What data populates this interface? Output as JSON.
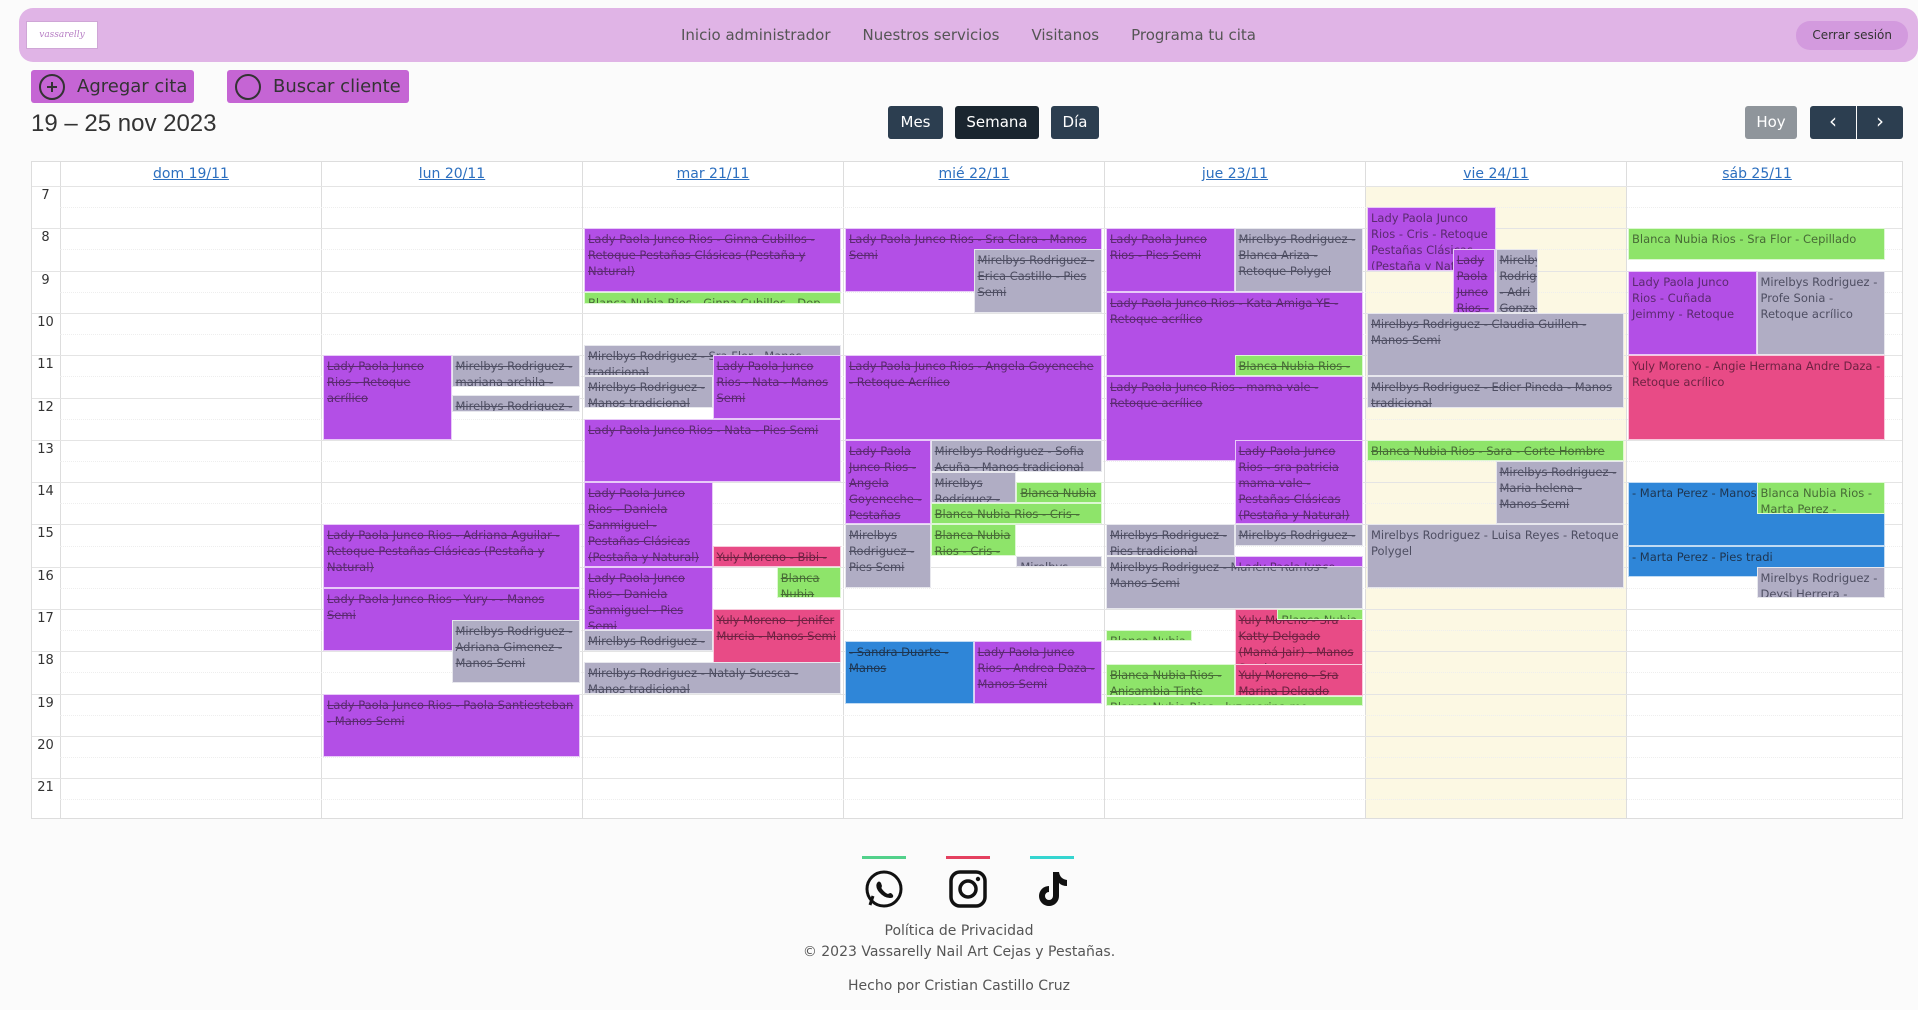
{
  "navbar": {
    "logo_text": "vassarelly",
    "links": [
      "Inicio administrador",
      "Nuestros servicios",
      "Visitanos",
      "Programa tu cita"
    ],
    "logout": "Cerrar sesión"
  },
  "actions": {
    "add": "Agregar cita",
    "search": "Buscar cliente"
  },
  "toolbar": {
    "range": "19 – 25 nov 2023",
    "views": [
      "Mes",
      "Semana",
      "Día"
    ],
    "active_view": "Semana",
    "today": "Hoy",
    "prev_icon": "chevron-left-icon",
    "next_icon": "chevron-right-icon"
  },
  "calendar": {
    "days": [
      "dom 19/11",
      "lun 20/11",
      "mar 21/11",
      "mié 22/11",
      "jue 23/11",
      "vie 24/11",
      "sáb 25/11"
    ],
    "today_index": 5,
    "hours": [
      "7",
      "8",
      "9",
      "10",
      "11",
      "12",
      "13",
      "14",
      "15",
      "16",
      "17",
      "18",
      "19",
      "20",
      "21"
    ],
    "event_colors": {
      "purple": "#b34fe6",
      "gray": "#b0adc4",
      "green": "#8ee46a",
      "pink": "#e84b86",
      "blue": "#2f86d8"
    },
    "events": [
      {
        "day": 1,
        "start": 11,
        "end": 13,
        "lane": 0,
        "lanes": 2,
        "color": "purple",
        "text": "Lady Paola Junco Rios - Retoque acrílico"
      },
      {
        "day": 1,
        "start": 11,
        "end": 11.75,
        "lane": 1,
        "lanes": 2,
        "color": "gray",
        "text": "Mirelbys Rodriguez - mariana archila -"
      },
      {
        "day": 1,
        "start": 11.95,
        "end": 12.35,
        "lane": 1,
        "lanes": 2,
        "color": "gray",
        "text": "Mirelbys Rodriguez -"
      },
      {
        "day": 1,
        "start": 15,
        "end": 16.5,
        "lane": 0,
        "lanes": 1,
        "color": "purple",
        "text": "Lady Paola Junco Rios - Adriana Aguilar - Retoque Pestañas Clásicas (Pestaña y Natural)"
      },
      {
        "day": 1,
        "start": 16.5,
        "end": 18,
        "lane": 0,
        "lanes": 1,
        "color": "purple",
        "text": "Lady Paola Junco Rios - Yury - - Manos Semi"
      },
      {
        "day": 1,
        "start": 17.25,
        "end": 18.75,
        "lane": 1,
        "lanes": 2,
        "color": "gray",
        "text": "Mirelbys Rodriguez - Adriana Gimenez - Manos Semi"
      },
      {
        "day": 1,
        "start": 19,
        "end": 20.5,
        "lane": 0,
        "lanes": 1,
        "color": "purple",
        "text": "Lady Paola Junco Rios - Paola Santiesteban - Manos Semi"
      },
      {
        "day": 2,
        "start": 8,
        "end": 9.5,
        "lane": 0,
        "lanes": 1,
        "color": "purple",
        "text": "Lady Paola Junco Rios - Ginna Cubillos - Retoque Pestañas Clásicas (Pestaña y Natural)"
      },
      {
        "day": 2,
        "start": 9.5,
        "end": 9.8,
        "lane": 0,
        "lanes": 1,
        "color": "green",
        "text": "Blanca Nubia Rios - Ginna Cubillos - Dep"
      },
      {
        "day": 2,
        "start": 10.75,
        "end": 11.5,
        "lane": 0,
        "lanes": 1,
        "color": "gray",
        "text": "Mirelbys Rodriguez - Sra Flor - Manos tradicional"
      },
      {
        "day": 2,
        "start": 11.5,
        "end": 12.25,
        "lane": 0,
        "lanes": 2,
        "color": "gray",
        "text": "Mirelbys Rodriguez - Manos tradicional"
      },
      {
        "day": 2,
        "start": 11,
        "end": 12.5,
        "lane": 1,
        "lanes": 2,
        "color": "purple",
        "text": "Lady Paola Junco Rios - Nata - Manos Semi"
      },
      {
        "day": 2,
        "start": 12.5,
        "end": 14,
        "lane": 0,
        "lanes": 1,
        "color": "purple",
        "text": "Lady Paola Junco Rios - Nata - Pies Semi"
      },
      {
        "day": 2,
        "start": 14,
        "end": 16,
        "lane": 0,
        "lanes": 2,
        "color": "purple",
        "text": "Lady Paola Junco Rios - Daniela Sanmiguel - Pestañas Clásicas (Pestaña y Natural)"
      },
      {
        "day": 2,
        "start": 15.5,
        "end": 16,
        "lane": 1,
        "lanes": 2,
        "color": "pink",
        "text": "Yuly Moreno - Bibi - Manos tradi"
      },
      {
        "day": 2,
        "start": 16,
        "end": 17.5,
        "lane": 0,
        "lanes": 2,
        "color": "purple",
        "text": "Lady Paola Junco Rios - Daniela Sanmiguel - Pies Semi"
      },
      {
        "day": 2,
        "start": 16,
        "end": 16.75,
        "lane": 3,
        "lanes": 4,
        "color": "green",
        "text": "Blanca Nubia Rios -"
      },
      {
        "day": 2,
        "start": 17.5,
        "end": 18,
        "lane": 0,
        "lanes": 2,
        "color": "gray",
        "text": "Mirelbys Rodriguez - Manos tra"
      },
      {
        "day": 2,
        "start": 17,
        "end": 18.5,
        "lane": 1,
        "lanes": 2,
        "color": "pink",
        "text": "Yuly Moreno - Jenifer Murcia - Manos Semi"
      },
      {
        "day": 2,
        "start": 18.25,
        "end": 19,
        "lane": 0,
        "lanes": 1,
        "color": "gray",
        "text": "Mirelbys Rodriguez - Nataly Suesca - Manos tradicional"
      },
      {
        "day": 3,
        "start": 8,
        "end": 9.5,
        "lane": 0,
        "lanes": 1,
        "color": "purple",
        "text": "Lady Paola Junco Rios - Sra Clara - Manos Semi"
      },
      {
        "day": 3,
        "start": 8.5,
        "end": 10,
        "lane": 1,
        "lanes": 2,
        "color": "gray",
        "text": "Mirelbys Rodriguez - Erica Castillo - Pies Semi"
      },
      {
        "day": 3,
        "start": 11,
        "end": 13,
        "lane": 0,
        "lanes": 1,
        "color": "purple",
        "text": "Lady Paola Junco Rios - Angela Goyeneche - Retoque Acrílico"
      },
      {
        "day": 3,
        "start": 13,
        "end": 15,
        "lane": 0,
        "lanes": 3,
        "color": "purple",
        "text": "Lady Paola Junco Rios - Angela Goyeneche - Pestañas Clásicas (Pestaña y Natural)"
      },
      {
        "day": 3,
        "start": 13,
        "end": 13.75,
        "lane": 1,
        "lanes": 3,
        "lanesSpan": 2,
        "color": "gray",
        "text": "Mirelbys Rodriguez - Sofia Acuña - Manos tradicional"
      },
      {
        "day": 3,
        "start": 13.75,
        "end": 14.5,
        "lane": 1,
        "lanes": 3,
        "color": "gray",
        "text": "Mirelbys Rodriguez - Sofia Acuña - Pies"
      },
      {
        "day": 3,
        "start": 14,
        "end": 14.5,
        "lane": 2,
        "lanes": 3,
        "color": "green",
        "text": "Blanca Nubia Rios"
      },
      {
        "day": 3,
        "start": 14.5,
        "end": 15,
        "lane": 1,
        "lanes": 3,
        "lanesSpan": 2,
        "color": "green",
        "text": "Blanca Nubia Rios - Cris -"
      },
      {
        "day": 3,
        "start": 15,
        "end": 16.5,
        "lane": 0,
        "lanes": 3,
        "color": "gray",
        "text": "Mirelbys Rodriguez - Pies Semi"
      },
      {
        "day": 3,
        "start": 15,
        "end": 15.75,
        "lane": 1,
        "lanes": 3,
        "color": "green",
        "text": "Blanca Nubia Rios - Cris - Cepillado"
      },
      {
        "day": 3,
        "start": 15.75,
        "end": 16,
        "lane": 2,
        "lanes": 3,
        "color": "gray",
        "text": "Mirelbys"
      },
      {
        "day": 3,
        "start": 17.75,
        "end": 19.25,
        "lane": 0,
        "lanes": 2,
        "color": "blue",
        "text": "- Sandra Duarte - Manos"
      },
      {
        "day": 3,
        "start": 17.75,
        "end": 19.25,
        "lane": 1,
        "lanes": 2,
        "color": "purple",
        "text": "Lady Paola Junco Rios - Andrea Daza - Manos Semi"
      },
      {
        "day": 4,
        "start": 8,
        "end": 9.5,
        "lane": 0,
        "lanes": 2,
        "color": "purple",
        "text": "Lady Paola Junco Rios - Pies Semi"
      },
      {
        "day": 4,
        "start": 8,
        "end": 9.5,
        "lane": 1,
        "lanes": 2,
        "color": "gray",
        "text": "Mirelbys Rodriguez - Blanca Ariza - Retoque Polygel"
      },
      {
        "day": 4,
        "start": 9.5,
        "end": 11.5,
        "lane": 0,
        "lanes": 1,
        "color": "purple",
        "text": "Lady Paola Junco Rios - Kata Amiga YE - Retoque acrílico"
      },
      {
        "day": 4,
        "start": 11,
        "end": 11.5,
        "lane": 1,
        "lanes": 2,
        "color": "green",
        "text": "Blanca Nubia Rios -"
      },
      {
        "day": 4,
        "start": 11.5,
        "end": 12,
        "lane": 1,
        "lanes": 2,
        "color": "green",
        "text": "Blanca Nubia Rios -"
      },
      {
        "day": 4,
        "start": 11.5,
        "end": 13.5,
        "lane": 0,
        "lanes": 1,
        "color": "purple",
        "text": "Lady Paola Junco Rios - mama vale - Retoque acrílico"
      },
      {
        "day": 4,
        "start": 13,
        "end": 15,
        "lane": 1,
        "lanes": 2,
        "color": "purple",
        "text": "Lady Paola Junco Rios - sra patricia mama vale - Pestañas Clásicas (Pestaña y Natural)"
      },
      {
        "day": 4,
        "start": 15,
        "end": 15.75,
        "lane": 0,
        "lanes": 2,
        "color": "gray",
        "text": "Mirelbys Rodriguez - Pies tradicional"
      },
      {
        "day": 4,
        "start": 15,
        "end": 15.5,
        "lane": 1,
        "lanes": 2,
        "color": "gray",
        "text": "Mirelbys Rodriguez -"
      },
      {
        "day": 4,
        "start": 15.75,
        "end": 17,
        "lane": 0,
        "lanes": 1,
        "color": "gray",
        "text": "Mirelbys Rodriguez - Marlene Ramos - Manos Semi"
      },
      {
        "day": 4,
        "start": 15.75,
        "end": 16,
        "lane": 1,
        "lanes": 2,
        "color": "purple",
        "text": "Lady Paola Junco Rios - sra"
      },
      {
        "day": 4,
        "start": 17,
        "end": 18.5,
        "lane": 1,
        "lanes": 2,
        "color": "pink",
        "text": "Yuly Moreno - Sra Katty Delgado (Mamá Jair) - Manos Semi"
      },
      {
        "day": 4,
        "start": 17,
        "end": 17.25,
        "lane": 2,
        "lanes": 3,
        "color": "green",
        "text": "Blanca Nubia"
      },
      {
        "day": 4,
        "start": 17.5,
        "end": 17.75,
        "lane": 0,
        "lanes": 3,
        "color": "green",
        "text": "Blanca Nubia R"
      },
      {
        "day": 4,
        "start": 18.3,
        "end": 19.05,
        "lane": 0,
        "lanes": 2,
        "color": "green",
        "text": "Blanca Nubia Rios - Anisambia Tinte"
      },
      {
        "day": 4,
        "start": 18.3,
        "end": 19.05,
        "lane": 1,
        "lanes": 2,
        "color": "pink",
        "text": "Yuly Moreno - Sra Marina Delgado"
      },
      {
        "day": 4,
        "start": 19.05,
        "end": 19.3,
        "lane": 0,
        "lanes": 1,
        "color": "green",
        "text": "Blanca Nubia Rios - luz marina mo"
      },
      {
        "day": 5,
        "start": 7.5,
        "end": 9,
        "lane": 0,
        "lanes": 2,
        "color": "purple",
        "nostrike": true,
        "text": "Lady Paola Junco Rios - Cris - Retoque Pestañas Clásicas (Pestaña y Natural)"
      },
      {
        "day": 5,
        "start": 8.5,
        "end": 10,
        "lane": 2,
        "lanes": 6,
        "color": "purple",
        "text": "Lady Paola Junco Rios - Adri Gonzalez - Pestañas Clásicas (Pestaña y Natural)"
      },
      {
        "day": 5,
        "start": 8.5,
        "end": 10,
        "lane": 3,
        "lanes": 6,
        "color": "gray",
        "text": "Mirelbys Rodriguez - Adri Gonzalez -"
      },
      {
        "day": 5,
        "start": 10,
        "end": 11.5,
        "lane": 0,
        "lanes": 1,
        "color": "gray",
        "text": "Mirelbys Rodriguez - Claudia Guillen - Manos Semi"
      },
      {
        "day": 5,
        "start": 11.5,
        "end": 12.25,
        "lane": 0,
        "lanes": 1,
        "color": "gray",
        "text": "Mirelbys Rodriguez - Edier Pineda - Manos tradicional"
      },
      {
        "day": 5,
        "start": 13,
        "end": 13.5,
        "lane": 0,
        "lanes": 1,
        "color": "green",
        "text": "Blanca Nubia Rios - Sara - Corte Hombre"
      },
      {
        "day": 5,
        "start": 13.5,
        "end": 15,
        "lane": 1,
        "lanes": 2,
        "color": "gray",
        "text": "Mirelbys Rodriguez - Maria helena - Manos Semi"
      },
      {
        "day": 5,
        "start": 15,
        "end": 16.5,
        "lane": 0,
        "lanes": 1,
        "color": "gray",
        "nostrike": true,
        "text": "Mirelbys Rodriguez - Luisa Reyes - Retoque Polygel"
      },
      {
        "day": 6,
        "start": 8,
        "end": 8.75,
        "lane": 0,
        "lanes": 1,
        "color": "green",
        "nostrike": true,
        "text": "Blanca Nubia Rios - Sra Flor - Cepillado"
      },
      {
        "day": 6,
        "start": 9,
        "end": 11,
        "lane": 0,
        "lanes": 2,
        "color": "purple",
        "nostrike": true,
        "text": "Lady Paola Junco Rios - Cuñada Jeimmy - Retoque"
      },
      {
        "day": 6,
        "start": 9,
        "end": 11,
        "lane": 1,
        "lanes": 2,
        "color": "gray",
        "nostrike": true,
        "text": "Mirelbys Rodriguez - Profe Sonia - Retoque acrílico"
      },
      {
        "day": 6,
        "start": 11,
        "end": 13,
        "lane": 0,
        "lanes": 1,
        "color": "pink",
        "nostrike": true,
        "text": "Yuly Moreno - Angie Hermana Andre Daza - Retoque acrílico"
      },
      {
        "day": 6,
        "start": 14,
        "end": 15.5,
        "lane": 0,
        "lanes": 1,
        "color": "blue",
        "nostrike": true,
        "text": "- Marta Perez - Manos Semi"
      },
      {
        "day": 6,
        "start": 14,
        "end": 14.75,
        "lane": 1,
        "lanes": 2,
        "color": "green",
        "nostrike": true,
        "text": "Blanca Nubia Rios - Marta Perez -"
      },
      {
        "day": 6,
        "start": 15.5,
        "end": 16.25,
        "lane": 0,
        "lanes": 1,
        "color": "blue",
        "nostrike": true,
        "text": "- Marta Perez - Pies tradi"
      },
      {
        "day": 6,
        "start": 16,
        "end": 16.75,
        "lane": 1,
        "lanes": 2,
        "color": "gray",
        "nostrike": true,
        "text": "Mirelbys Rodriguez - Deysi Herrera -"
      }
    ]
  },
  "footer": {
    "icons": [
      {
        "name": "whatsapp-icon",
        "bar_color": "#52d18b"
      },
      {
        "name": "instagram-icon",
        "bar_color": "#e4405f"
      },
      {
        "name": "tiktok-icon",
        "bar_color": "#35d5d0"
      }
    ],
    "privacy": "Política de Privacidad",
    "copyright": "© 2023 Vassarelly Nail Art Cejas y Pestañas.",
    "credit": "Hecho por Cristian Castillo Cruz"
  }
}
